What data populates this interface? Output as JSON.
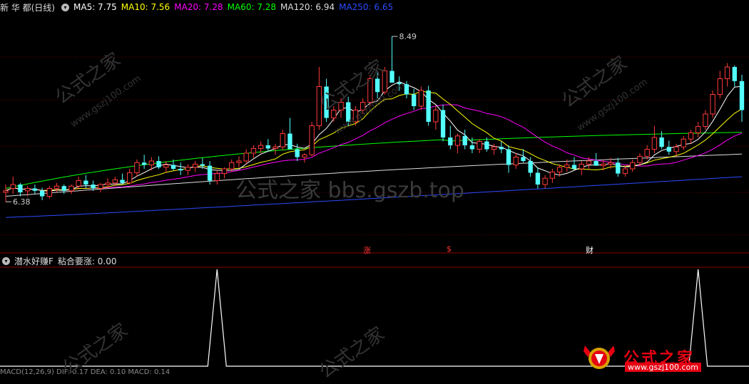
{
  "header": {
    "title": "新 华 都(日线)",
    "ma": [
      {
        "label": "MA5: 7.75",
        "color": "#ffffff"
      },
      {
        "label": "MA10: 7.56",
        "color": "#ffff00"
      },
      {
        "label": "MA20: 7.28",
        "color": "#ff00ff"
      },
      {
        "label": "MA60: 7.28",
        "color": "#00ff00"
      },
      {
        "label": "MA120: 6.94",
        "color": "#dddddd"
      },
      {
        "label": "MA250: 6.65",
        "color": "#2b4bff"
      }
    ]
  },
  "price_labels": {
    "high": "8.49",
    "low": "6.38"
  },
  "markers": [
    {
      "text": "涨",
      "color": "#ff3333"
    },
    {
      "text": "$",
      "color": "#ff3333"
    },
    {
      "text": "财",
      "color": "#ffffff"
    }
  ],
  "indicator": {
    "title": "潜水好赚F",
    "value": "粘合要涨: 0.00"
  },
  "macd_header": "MACD(12,26,9)  DIF: 0.17  DEA: 0.10  MACD: 0.14",
  "watermarks": {
    "center": "公式之家 bbs.gszb.top",
    "tile": "公式之家",
    "tile_url": "www.gszj100.com"
  },
  "logo": {
    "text": "公式之家",
    "url": "www.gszj100.com"
  },
  "colors": {
    "up": "#ff3a3a",
    "down": "#54ffff",
    "bg": "#000000",
    "grid": "#7a0000"
  },
  "chart_data": {
    "type": "candlestick",
    "y_range": [
      6.0,
      8.7
    ],
    "candles": [
      [
        6.5,
        6.6,
        6.38,
        6.52
      ],
      [
        6.55,
        6.7,
        6.48,
        6.6
      ],
      [
        6.6,
        6.62,
        6.45,
        6.5
      ],
      [
        6.52,
        6.58,
        6.45,
        6.55
      ],
      [
        6.55,
        6.6,
        6.48,
        6.52
      ],
      [
        6.52,
        6.56,
        6.4,
        6.45
      ],
      [
        6.45,
        6.58,
        6.42,
        6.55
      ],
      [
        6.55,
        6.62,
        6.5,
        6.58
      ],
      [
        6.58,
        6.6,
        6.48,
        6.52
      ],
      [
        6.52,
        6.6,
        6.48,
        6.58
      ],
      [
        6.58,
        6.7,
        6.55,
        6.65
      ],
      [
        6.65,
        6.72,
        6.55,
        6.6
      ],
      [
        6.6,
        6.65,
        6.52,
        6.55
      ],
      [
        6.55,
        6.62,
        6.5,
        6.6
      ],
      [
        6.6,
        6.68,
        6.55,
        6.62
      ],
      [
        6.62,
        6.7,
        6.58,
        6.66
      ],
      [
        6.66,
        6.74,
        6.6,
        6.62
      ],
      [
        6.62,
        6.8,
        6.6,
        6.75
      ],
      [
        6.75,
        6.92,
        6.7,
        6.88
      ],
      [
        6.88,
        6.98,
        6.8,
        6.85
      ],
      [
        6.85,
        6.95,
        6.78,
        6.9
      ],
      [
        6.9,
        6.96,
        6.8,
        6.82
      ],
      [
        6.82,
        6.9,
        6.75,
        6.85
      ],
      [
        6.85,
        6.92,
        6.78,
        6.8
      ],
      [
        6.8,
        6.88,
        6.72,
        6.78
      ],
      [
        6.78,
        6.86,
        6.72,
        6.82
      ],
      [
        6.82,
        6.9,
        6.76,
        6.86
      ],
      [
        6.86,
        6.94,
        6.8,
        6.84
      ],
      [
        6.84,
        6.9,
        6.6,
        6.65
      ],
      [
        6.65,
        6.78,
        6.6,
        6.74
      ],
      [
        6.74,
        6.82,
        6.68,
        6.8
      ],
      [
        6.8,
        6.92,
        6.76,
        6.88
      ],
      [
        6.88,
        6.96,
        6.82,
        6.9
      ],
      [
        6.9,
        7.05,
        6.86,
        7.0
      ],
      [
        7.0,
        7.1,
        6.94,
        7.06
      ],
      [
        7.06,
        7.15,
        7.0,
        7.1
      ],
      [
        7.1,
        7.18,
        7.02,
        7.06
      ],
      [
        7.06,
        7.12,
        6.98,
        7.08
      ],
      [
        7.08,
        7.3,
        7.04,
        7.25
      ],
      [
        7.25,
        7.45,
        7.2,
        7.05
      ],
      [
        7.05,
        7.12,
        6.9,
        6.95
      ],
      [
        6.95,
        7.0,
        6.88,
        6.98
      ],
      [
        6.98,
        7.4,
        6.96,
        7.35
      ],
      [
        7.35,
        8.1,
        7.3,
        7.85
      ],
      [
        7.85,
        7.95,
        7.4,
        7.45
      ],
      [
        7.45,
        7.6,
        7.4,
        7.55
      ],
      [
        7.55,
        7.7,
        7.45,
        7.65
      ],
      [
        7.65,
        7.72,
        7.35,
        7.4
      ],
      [
        7.4,
        7.6,
        7.35,
        7.55
      ],
      [
        7.55,
        7.7,
        7.5,
        7.65
      ],
      [
        7.65,
        8.0,
        7.6,
        7.95
      ],
      [
        7.95,
        8.05,
        7.7,
        7.78
      ],
      [
        7.78,
        8.1,
        7.75,
        8.05
      ],
      [
        8.05,
        8.49,
        7.98,
        7.9
      ],
      [
        7.9,
        7.98,
        7.8,
        7.88
      ],
      [
        7.88,
        7.92,
        7.7,
        7.75
      ],
      [
        7.75,
        7.82,
        7.55,
        7.6
      ],
      [
        7.6,
        7.85,
        7.55,
        7.8
      ],
      [
        7.8,
        7.86,
        7.35,
        7.4
      ],
      [
        7.4,
        7.6,
        7.3,
        7.55
      ],
      [
        7.55,
        7.62,
        7.15,
        7.2
      ],
      [
        7.2,
        7.35,
        7.05,
        7.1
      ],
      [
        7.1,
        7.25,
        7.0,
        7.22
      ],
      [
        7.22,
        7.3,
        7.05,
        7.1
      ],
      [
        7.1,
        7.2,
        7.0,
        7.05
      ],
      [
        7.05,
        7.18,
        7.0,
        7.15
      ],
      [
        7.15,
        7.2,
        7.02,
        7.05
      ],
      [
        7.05,
        7.12,
        6.98,
        7.08
      ],
      [
        7.08,
        7.15,
        7.0,
        7.05
      ],
      [
        7.05,
        7.1,
        6.75,
        6.85
      ],
      [
        6.85,
        7.0,
        6.8,
        6.95
      ],
      [
        6.95,
        7.05,
        6.88,
        6.9
      ],
      [
        6.9,
        6.95,
        6.7,
        6.75
      ],
      [
        6.75,
        6.82,
        6.55,
        6.6
      ],
      [
        6.6,
        6.72,
        6.55,
        6.68
      ],
      [
        6.68,
        6.8,
        6.62,
        6.76
      ],
      [
        6.76,
        6.86,
        6.7,
        6.82
      ],
      [
        6.82,
        6.92,
        6.76,
        6.85
      ],
      [
        6.85,
        6.95,
        6.78,
        6.8
      ],
      [
        6.8,
        6.9,
        6.72,
        6.86
      ],
      [
        6.86,
        6.95,
        6.8,
        6.9
      ],
      [
        6.9,
        7.0,
        6.84,
        6.84
      ],
      [
        6.84,
        6.92,
        6.78,
        6.86
      ],
      [
        6.86,
        6.94,
        6.8,
        6.88
      ],
      [
        6.88,
        6.94,
        6.7,
        6.74
      ],
      [
        6.74,
        6.84,
        6.7,
        6.8
      ],
      [
        6.8,
        6.92,
        6.76,
        6.88
      ],
      [
        6.88,
        7.0,
        6.84,
        6.96
      ],
      [
        6.96,
        7.1,
        6.92,
        7.05
      ],
      [
        7.05,
        7.35,
        7.0,
        7.2
      ],
      [
        7.2,
        7.28,
        7.05,
        7.08
      ],
      [
        7.08,
        7.16,
        6.98,
        7.02
      ],
      [
        7.02,
        7.12,
        6.96,
        7.08
      ],
      [
        7.08,
        7.22,
        7.04,
        7.18
      ],
      [
        7.18,
        7.3,
        7.12,
        7.26
      ],
      [
        7.26,
        7.4,
        7.2,
        7.34
      ],
      [
        7.34,
        7.55,
        7.3,
        7.5
      ],
      [
        7.5,
        7.8,
        7.45,
        7.75
      ],
      [
        7.75,
        8.05,
        7.7,
        7.95
      ],
      [
        7.95,
        8.15,
        7.85,
        8.1
      ],
      [
        8.1,
        8.12,
        7.85,
        7.92
      ],
      [
        7.92,
        8.0,
        7.4,
        7.55
      ]
    ],
    "indicator_spikes": [
      {
        "index": 29,
        "value": 1.0
      },
      {
        "index": 95,
        "value": 1.0
      }
    ]
  }
}
